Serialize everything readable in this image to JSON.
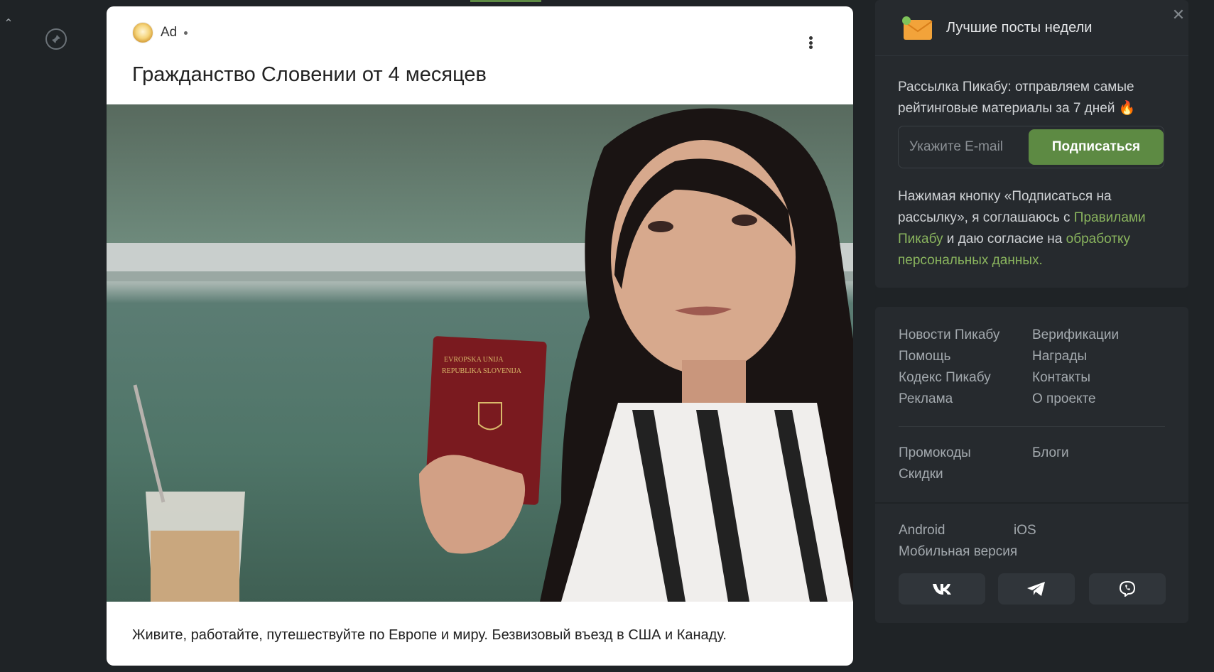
{
  "ad": {
    "label": "Ad",
    "title": "Гражданство Словении от 4 месяцев",
    "description": "Живите, работайте, путешествуйте по Европе и миру. Безвизовый въезд в США и Канаду.",
    "image_passport_line1": "EVROPSKA UNIJA",
    "image_passport_line2": "REPUBLIKA SLOVENIJA"
  },
  "newsletter": {
    "title": "Лучшие посты недели",
    "description": "Рассылка Пикабу: отправляем самые рейтинговые материалы за 7 дней 🔥",
    "email_placeholder": "Укажите E-mail",
    "subscribe_label": "Подписаться",
    "consent_part1": "Нажимая кнопку «Подписаться на рассылку», я соглашаюсь с ",
    "consent_link1": "Правилами Пикабу",
    "consent_part2": " и даю согласие на ",
    "consent_link2": "обработку персональных данных",
    "consent_end": "."
  },
  "footer_links": {
    "group1_left": [
      "Новости Пикабу",
      "Помощь",
      "Кодекс Пикабу",
      "Реклама"
    ],
    "group1_right": [
      "Верификации",
      "Награды",
      "Контакты",
      "О проекте"
    ],
    "group2_left": [
      "Промокоды",
      "Скидки"
    ],
    "group2_right": [
      "Блоги"
    ],
    "apps": {
      "android": "Android",
      "ios": "iOS",
      "mobile": "Мобильная версия"
    }
  },
  "social": [
    "vk-icon",
    "telegram-icon",
    "viber-icon"
  ],
  "colors": {
    "accent": "#5d8a43",
    "link": "#8ab55e",
    "bg": "#1f2326",
    "card": "#262a2e"
  }
}
